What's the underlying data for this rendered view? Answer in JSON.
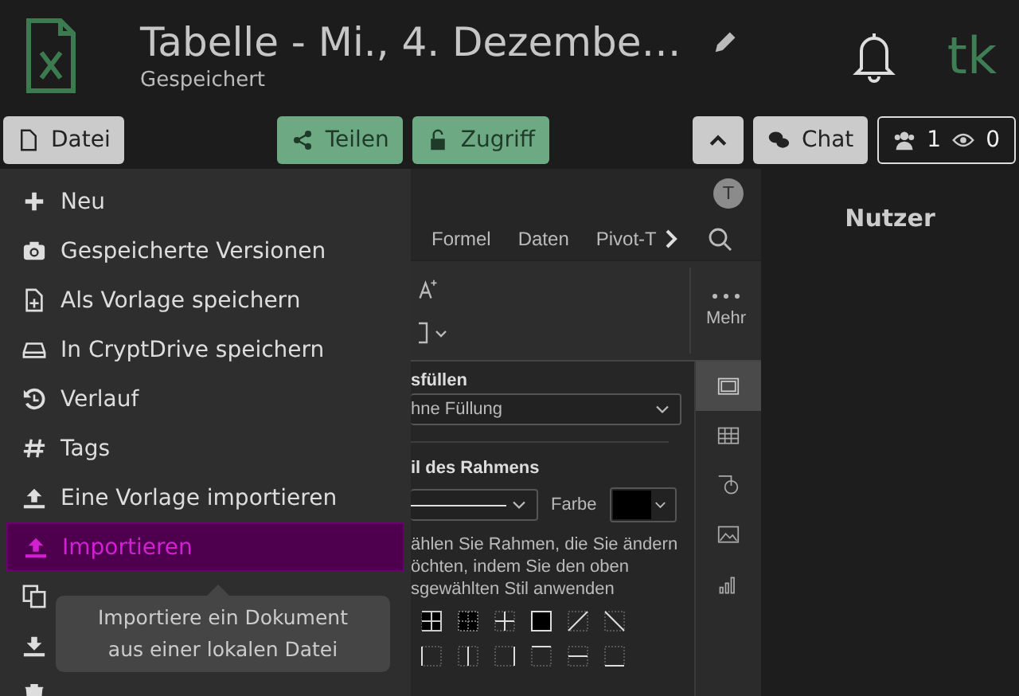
{
  "header": {
    "title": "Tabelle - Mi., 4. Dezembe…",
    "status": "Gespeichert",
    "avatar": "tk"
  },
  "toolbar": {
    "buttons": [
      {
        "kind": "file",
        "label": "Datei"
      },
      {
        "kind": "share",
        "label": "Teilen"
      },
      {
        "kind": "access",
        "label": "Zugriff"
      }
    ],
    "chat": "Chat",
    "users": "1",
    "viewers": "0"
  },
  "file_menu": {
    "items": [
      {
        "kind": "plus",
        "label": "Neu",
        "selected": false
      },
      {
        "kind": "camera",
        "label": "Gespeicherte Versionen",
        "selected": false
      },
      {
        "kind": "file-plus",
        "label": "Als Vorlage speichern",
        "selected": false
      },
      {
        "kind": "drive",
        "label": "In CryptDrive speichern",
        "selected": false
      },
      {
        "kind": "history",
        "label": "Verlauf",
        "selected": false
      },
      {
        "kind": "hash",
        "label": "Tags",
        "selected": false
      },
      {
        "kind": "upload",
        "label": "Eine Vorlage importieren",
        "selected": false
      },
      {
        "kind": "upload",
        "label": "Importieren",
        "selected": true
      },
      {
        "kind": "copy",
        "selected": false
      },
      {
        "kind": "download",
        "selected": false
      },
      {
        "kind": "trash",
        "selected": false
      }
    ],
    "tooltip": "Importiere ein Dokument\naus einer lokalen Datei"
  },
  "spreadsheet": {
    "avatar": "T",
    "tabs": [
      "Formel",
      "Daten",
      "Pivot-T"
    ],
    "more": "Mehr",
    "fill_label": "sfüllen",
    "fill_value": "hne Füllung",
    "border_label": "il des Rahmens",
    "color_label": "Farbe",
    "hint": "ählen Sie Rahmen, die Sie ändern\nöchten, indem Sie den oben\nsgewählten Stil anwenden",
    "side_tabs": [
      {
        "kind": "cell",
        "selected": true
      },
      {
        "kind": "table",
        "selected": false
      },
      {
        "kind": "shape",
        "selected": false
      },
      {
        "kind": "image",
        "selected": false
      },
      {
        "kind": "chart",
        "selected": false
      }
    ]
  },
  "users_panel": {
    "title": "Nutzer"
  }
}
